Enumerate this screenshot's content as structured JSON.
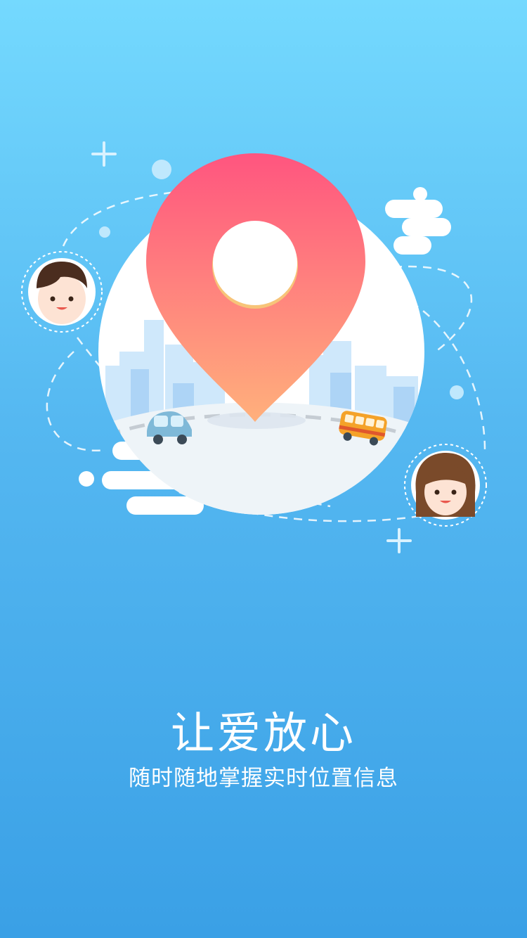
{
  "screen": {
    "headline": "让爱放心",
    "subtitle": "随时随地掌握实时位置信息"
  },
  "illustration": {
    "icons": [
      "map-pin-icon",
      "boy-avatar",
      "girl-avatar",
      "car-icon",
      "bus-icon",
      "city-skyline",
      "plus-sparkle-icon"
    ]
  },
  "colors": {
    "background_top": "#74d9fe",
    "background_bottom": "#3aa0e6",
    "pin_top": "#ff557f",
    "pin_bottom": "#ffb07c",
    "text": "#ffffff"
  }
}
